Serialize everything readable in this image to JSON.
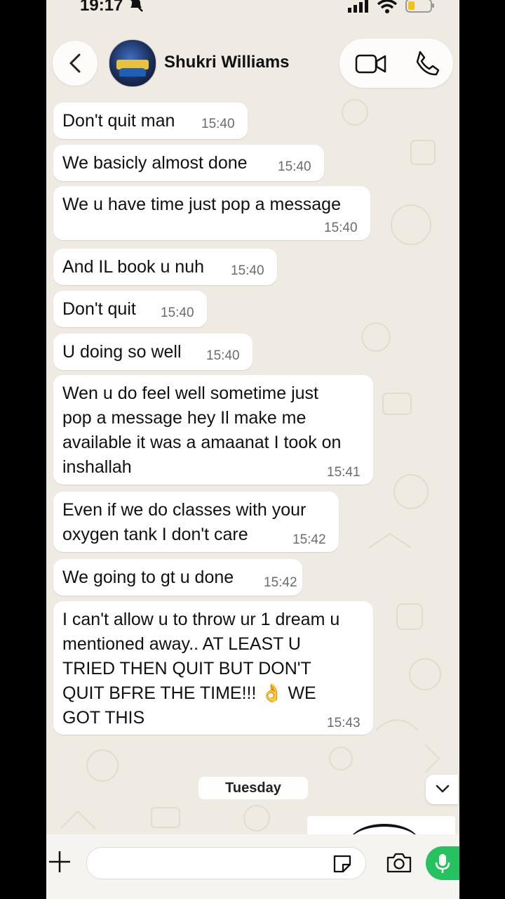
{
  "status_bar": {
    "time": "19:17"
  },
  "header": {
    "contact_name": "Shukri Williams"
  },
  "messages": [
    {
      "text": "Don't quit man",
      "time": "15:40"
    },
    {
      "text": "We basicly almost done",
      "time": "15:40"
    },
    {
      "text": "We u have time just pop a message",
      "time": "15:40"
    },
    {
      "text": "And IL book u nuh",
      "time": "15:40"
    },
    {
      "text": "Don't quit",
      "time": "15:40"
    },
    {
      "text": "U doing so well",
      "time": "15:40"
    },
    {
      "lines": [
        "Wen u do feel well sometime just",
        "pop a message hey Il make me",
        "available it was a amaanat I took on",
        "inshallah"
      ],
      "time": "15:41"
    },
    {
      "lines": [
        "Even if we do classes with your",
        "oxygen tank I don't care"
      ],
      "time": "15:42"
    },
    {
      "text": "We going to gt u done",
      "time": "15:42"
    },
    {
      "lines": [
        "I can't allow u to throw ur 1 dream u",
        "mentioned away.. AT LEAST U",
        "TRIED THEN QUIT BUT DON'T",
        "QUIT BFRE THE TIME!!! 👌 WE",
        "GOT THIS"
      ],
      "time": "15:43"
    }
  ],
  "day_separator": "Tuesday",
  "input": {
    "placeholder": ""
  },
  "colors": {
    "chat_bg": "#efeae2",
    "bubble": "#ffffff",
    "mic": "#25c25f"
  },
  "icons": [
    "back-chevron-icon",
    "video-call-icon",
    "phone-icon",
    "plus-icon",
    "sticker-icon",
    "camera-icon",
    "mic-icon",
    "chevron-down-icon"
  ]
}
